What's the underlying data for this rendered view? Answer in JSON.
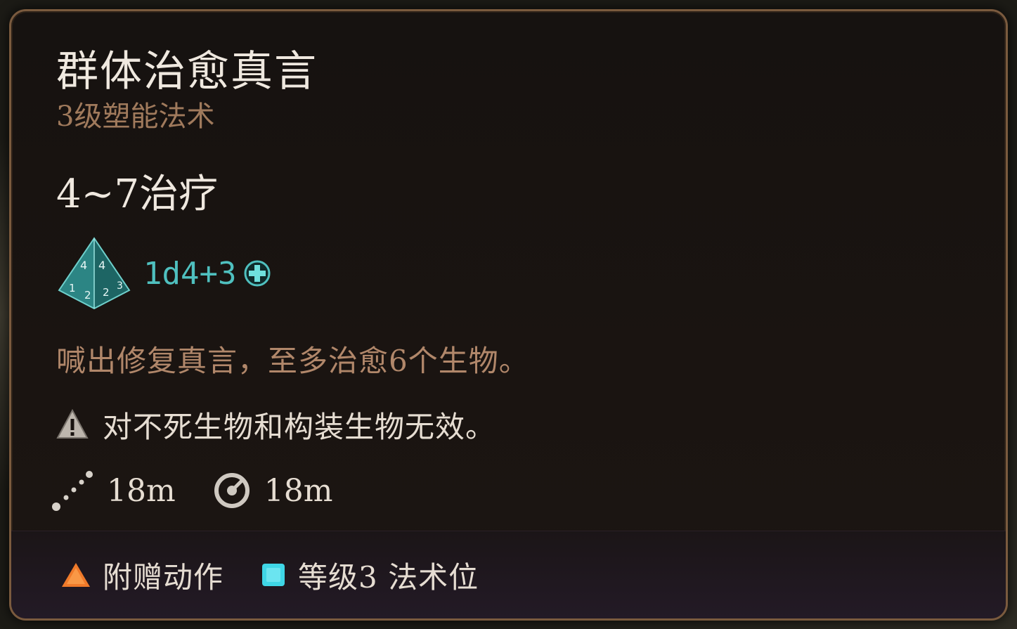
{
  "spell": {
    "name": "群体治愈真言",
    "level_school": "3级塑能法术",
    "effect": "4~7治疗",
    "dice_formula": "1d4+3",
    "description": "喊出修复真言，至多治愈6个生物。",
    "warning": "对不死生物和构装生物无效。",
    "range": "18m",
    "area_radius": "18m"
  },
  "footer": {
    "action_cost": "附赠动作",
    "slot_cost": "等级3 法术位"
  },
  "icons": {
    "dice": "d4-die-icon",
    "heal": "heal-plus-icon",
    "warning": "warning-icon",
    "range": "range-icon",
    "radius": "radius-icon",
    "action": "bonus-action-triangle-icon",
    "slot": "spell-slot-square-icon"
  },
  "colors": {
    "accent_teal": "#4fc0bf",
    "subtitle_bronze": "#a07a5c",
    "border_bronze": "#7a5a3e",
    "action_orange": "#f07a2a",
    "slot_cyan": "#3fd6e6"
  }
}
